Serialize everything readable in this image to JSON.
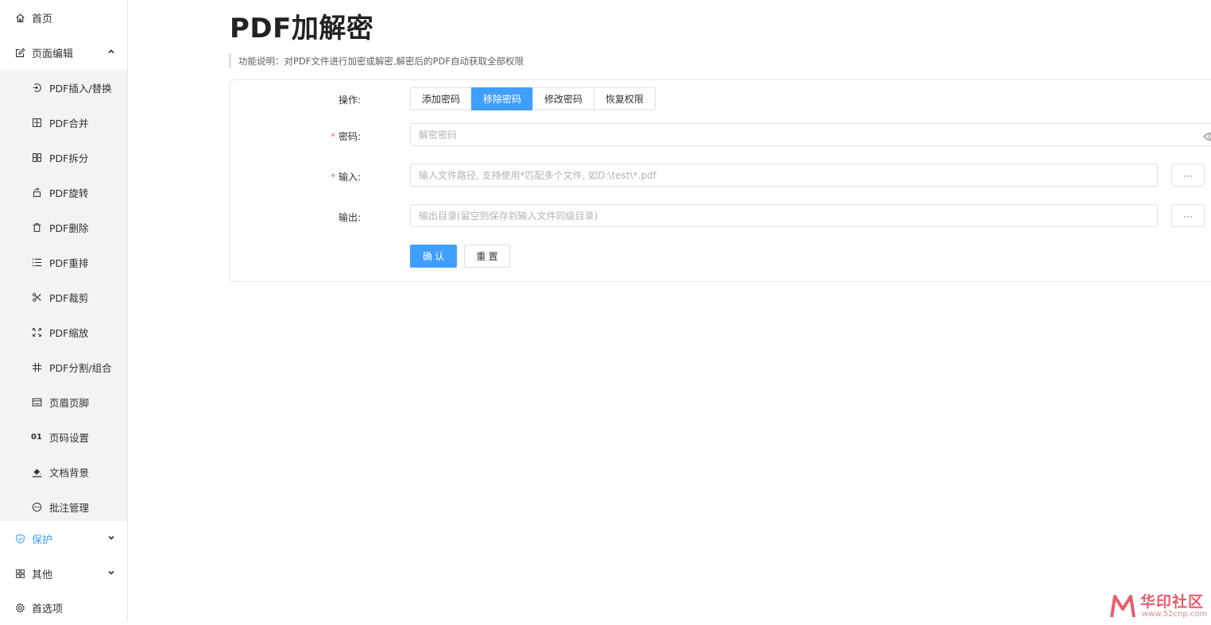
{
  "sidebar": {
    "home": {
      "label": "首页",
      "icon": "home-icon"
    },
    "page_edit": {
      "label": "页面编辑",
      "icon": "edit-icon",
      "expanded": true
    },
    "sub_items": [
      {
        "label": "PDF插入/替换",
        "icon": "insert-icon"
      },
      {
        "label": "PDF合并",
        "icon": "merge-icon"
      },
      {
        "label": "PDF拆分",
        "icon": "split-icon"
      },
      {
        "label": "PDF旋转",
        "icon": "rotate-icon"
      },
      {
        "label": "PDF删除",
        "icon": "trash-icon"
      },
      {
        "label": "PDF重排",
        "icon": "list-icon"
      },
      {
        "label": "PDF裁剪",
        "icon": "scissors-icon"
      },
      {
        "label": "PDF缩放",
        "icon": "scale-icon"
      },
      {
        "label": "PDF分割/组合",
        "icon": "grid-icon"
      },
      {
        "label": "页眉页脚",
        "icon": "header-footer-icon"
      },
      {
        "label": "页码设置",
        "icon": "page-number-icon",
        "glyph": "01"
      },
      {
        "label": "文档背景",
        "icon": "paint-bucket-icon"
      },
      {
        "label": "批注管理",
        "icon": "comment-icon"
      }
    ],
    "protect": {
      "label": "保护",
      "icon": "shield-icon",
      "active": true
    },
    "other": {
      "label": "其他",
      "icon": "apps-icon"
    },
    "preferences": {
      "label": "首选项",
      "icon": "gear-icon"
    }
  },
  "main": {
    "title": "PDF加解密",
    "description": "功能说明：对PDF文件进行加密或解密,解密后的PDF自动获取全部权限",
    "form": {
      "operation_label": "操作:",
      "operations": [
        "添加密码",
        "移除密码",
        "修改密码",
        "恢复权限"
      ],
      "selected_operation": "移除密码",
      "password_label": "密码:",
      "password_placeholder": "解密密码",
      "input_label": "输入:",
      "input_placeholder": "输入文件路径, 支持使用*匹配多个文件, 如D:\\test\\*.pdf",
      "output_label": "输出:",
      "output_placeholder": "输出目录(留空则保存到输入文件同级目录)",
      "browse_label": "···",
      "confirm_label": "确 认",
      "reset_label": "重 置"
    }
  },
  "watermark": {
    "text": "华印社区",
    "url": "www.52cnp.com"
  },
  "colors": {
    "accent": "#409eff",
    "required": "#f56c6c",
    "submenu_bg": "#f2f3f5"
  }
}
